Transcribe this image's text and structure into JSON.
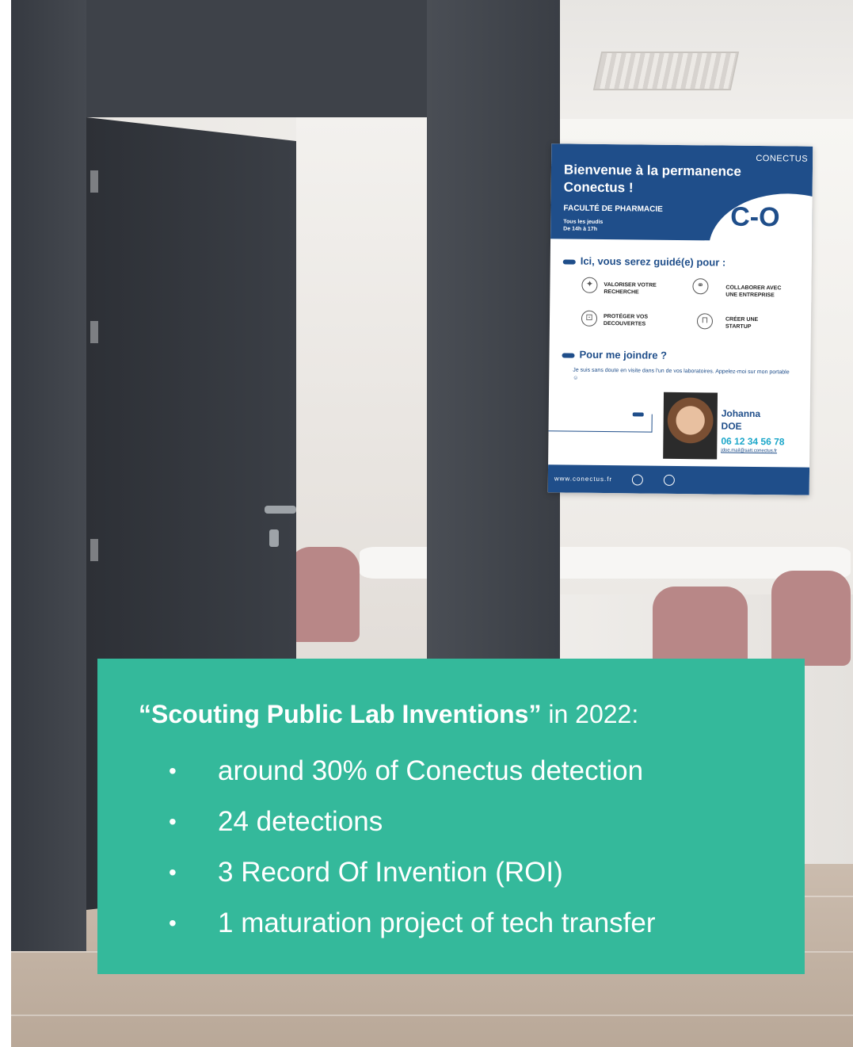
{
  "poster": {
    "brand": "CONECTUS",
    "welcome_line1": "Bienvenue à la permanence",
    "welcome_line2": "Conectus !",
    "faculty": "FACULTÉ DE PHARMACIE",
    "schedule_line1": "Tous les jeudis",
    "schedule_line2": "De 14h à 17h",
    "logo": "C-O",
    "section_guide": "Ici, vous serez guidé(e) pour :",
    "services": [
      {
        "icon": "lightbulb-icon",
        "label": "VALORISER VOTRE RECHERCHE"
      },
      {
        "icon": "handshake-icon",
        "label": "COLLABORER AVEC UNE ENTREPRISE"
      },
      {
        "icon": "padlock-icon",
        "label": "PROTÉGER VOS DECOUVERTES"
      },
      {
        "icon": "shirt-icon",
        "label": "CRÉER UNE STARTUP"
      }
    ],
    "section_contact": "Pour me joindre ?",
    "note": "Je suis sans doute en visite dans l'un de vos laboratoires. Appelez-moi sur mon portable ☺",
    "contact_first": "Johanna",
    "contact_last": "DOE",
    "phone": "06 12 34 56 78",
    "email": "jdoe.mail@satt.conectus.fr",
    "website": "www.conectus.fr",
    "accent": "#1f4e8a"
  },
  "overlay": {
    "title_bold": "“Scouting Public Lab Inventions”",
    "title_rest": " in 2022:",
    "bullet_char": "•",
    "items": [
      "around 30% of Conectus detection",
      "24 detections",
      "3 Record Of Invention (ROI)",
      "1 maturation project of tech transfer"
    ],
    "background": "#34b99b"
  }
}
